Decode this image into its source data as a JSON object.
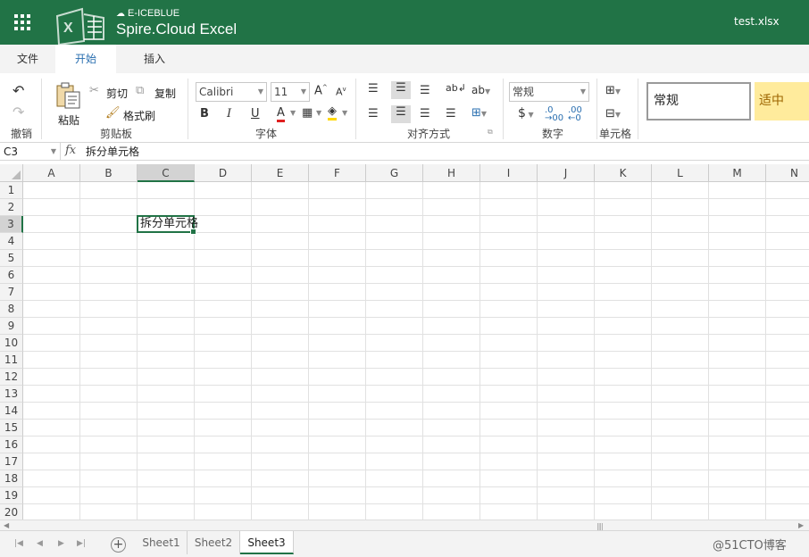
{
  "titlebar": {
    "brand_small": "E-ICEBLUE",
    "brand_big": "Spire.Cloud Excel",
    "filename": "test.xlsx"
  },
  "tabs": [
    "文件",
    "开始",
    "插入"
  ],
  "active_tab": "开始",
  "ribbon": {
    "undo_label": "撤销",
    "paste_label": "粘贴",
    "cut_label": "剪切",
    "copy_label": "复制",
    "format_painter_label": "格式刷",
    "clipboard_group": "剪贴板",
    "font_name": "Calibri",
    "font_size": "11",
    "font_group": "字体",
    "bold": "B",
    "italic": "I",
    "underline": "U",
    "font_color": "A",
    "grow_font": "A",
    "shrink_font": "A",
    "wrap_text": "ab",
    "orientation": "ab",
    "align_group": "对齐方式",
    "number_format": "常规",
    "currency": "$",
    "number_group": "数字",
    "cells_group": "单元格",
    "style_normal": "常规",
    "style_neutral": "适中"
  },
  "formula_bar": {
    "name_box": "C3",
    "fx": "fx",
    "formula": "拆分单元格"
  },
  "grid": {
    "columns": [
      "A",
      "B",
      "C",
      "D",
      "E",
      "F",
      "G",
      "H",
      "I",
      "J",
      "K",
      "L",
      "M",
      "N"
    ],
    "rows": [
      "1",
      "2",
      "3",
      "4",
      "5",
      "6",
      "7",
      "8",
      "9",
      "10",
      "11",
      "12",
      "13",
      "14",
      "15",
      "16",
      "17",
      "18",
      "19",
      "20"
    ],
    "selected_column": "C",
    "selected_row": "3",
    "cell_value": "拆分单元格"
  },
  "sheets": [
    "Sheet1",
    "Sheet2",
    "Sheet3"
  ],
  "active_sheet": "Sheet3",
  "watermark": "@51CTO博客",
  "colors": {
    "accent": "#217346",
    "tab_active_text": "#2a6fb0",
    "neutral_bg": "#ffeb9c"
  }
}
